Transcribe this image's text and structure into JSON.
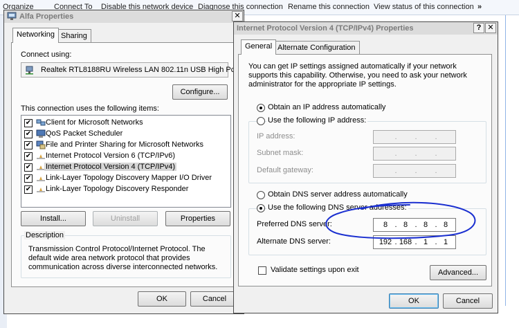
{
  "background": {
    "command_bar": [
      "Organize",
      "Connect To",
      "Disable this network device",
      "Diagnose this connection",
      "Rename this connection",
      "View status of this connection",
      "»"
    ]
  },
  "alfa": {
    "title": "Alfa Properties",
    "close": "✕",
    "tabs": [
      "Networking",
      "Sharing"
    ],
    "connect_using_label": "Connect using:",
    "adapter": "Realtek RTL8188RU Wireless LAN 802.11n USB High Pc",
    "configure": "Configure...",
    "items_label": "This connection uses the following items:",
    "items": [
      "Client for Microsoft Networks",
      "QoS Packet Scheduler",
      "File and Printer Sharing for Microsoft Networks",
      "Internet Protocol Version 6 (TCP/IPv6)",
      "Internet Protocol Version 4 (TCP/IPv4)",
      "Link-Layer Topology Discovery Mapper I/O Driver",
      "Link-Layer Topology Discovery Responder"
    ],
    "install": "Install...",
    "uninstall": "Uninstall",
    "properties": "Properties",
    "description_title": "Description",
    "description": "Transmission Control Protocol/Internet Protocol. The default wide area network protocol that provides communication across diverse interconnected networks.",
    "ok": "OK",
    "cancel": "Cancel"
  },
  "ipv4": {
    "title": "Internet Protocol Version 4 (TCP/IPv4) Properties",
    "help": "?",
    "close": "✕",
    "tabs": [
      "General",
      "Alternate Configuration"
    ],
    "intro": "You can get IP settings assigned automatically if your network supports this capability. Otherwise, you need to ask your network administrator for the appropriate IP settings.",
    "obtain_ip": "Obtain an IP address automatically",
    "use_ip": "Use the following IP address:",
    "ip_address": "IP address:",
    "subnet": "Subnet mask:",
    "gateway": "Default gateway:",
    "obtain_dns": "Obtain DNS server address automatically",
    "use_dns": "Use the following DNS server addresses:",
    "preferred": "Preferred DNS server:",
    "alternate": "Alternate DNS server:",
    "preferred_value": [
      "8",
      "8",
      "8",
      "8"
    ],
    "alternate_value": [
      "192",
      "168",
      "1",
      "1"
    ],
    "validate": "Validate settings upon exit",
    "advanced": "Advanced...",
    "ok": "OK",
    "cancel": "Cancel"
  },
  "colors": {
    "annotation": "#1a2fd0"
  }
}
